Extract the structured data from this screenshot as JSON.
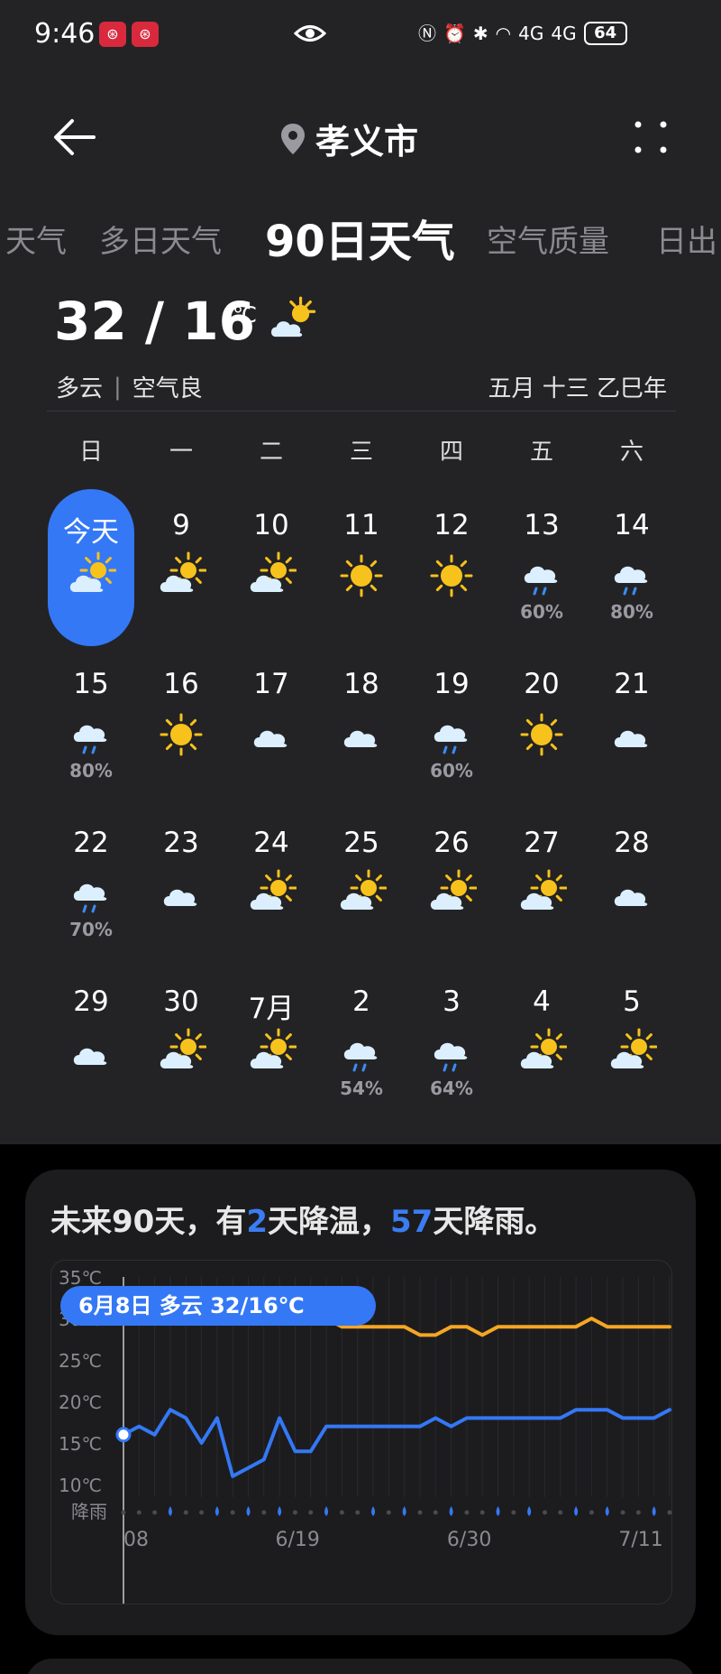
{
  "status_bar": {
    "time": "9:46",
    "badge": "AIR",
    "network": "4G",
    "battery": "64"
  },
  "header": {
    "location": "孝义市",
    "icons": [
      "back-arrow-icon",
      "location-pin-icon",
      "more-grid-icon"
    ]
  },
  "tabs": [
    {
      "label": "天气",
      "active": false
    },
    {
      "label": "多日天气",
      "active": false
    },
    {
      "label": "90日天气",
      "active": true
    },
    {
      "label": "空气质量",
      "active": false
    },
    {
      "label": "日出",
      "active": false
    }
  ],
  "today": {
    "temp": "32 / 16",
    "unit": "℃",
    "weather": "多云",
    "air": "空气良",
    "lunar": "五月 十三 乙巳年",
    "icon": "partly-cloudy-icon"
  },
  "calendar": {
    "weekdays": [
      "日",
      "一",
      "二",
      "三",
      "四",
      "五",
      "六"
    ],
    "days": [
      {
        "label": "今天",
        "icon": "partly",
        "pct": "",
        "today": true
      },
      {
        "label": "9",
        "icon": "partly",
        "pct": ""
      },
      {
        "label": "10",
        "icon": "partly",
        "pct": ""
      },
      {
        "label": "11",
        "icon": "sun",
        "pct": ""
      },
      {
        "label": "12",
        "icon": "sun",
        "pct": ""
      },
      {
        "label": "13",
        "icon": "rain",
        "pct": "60%"
      },
      {
        "label": "14",
        "icon": "rain",
        "pct": "80%"
      },
      {
        "label": "15",
        "icon": "rain",
        "pct": "80%"
      },
      {
        "label": "16",
        "icon": "sun",
        "pct": ""
      },
      {
        "label": "17",
        "icon": "cloud",
        "pct": ""
      },
      {
        "label": "18",
        "icon": "cloud",
        "pct": ""
      },
      {
        "label": "19",
        "icon": "rain",
        "pct": "60%"
      },
      {
        "label": "20",
        "icon": "sun",
        "pct": ""
      },
      {
        "label": "21",
        "icon": "cloud",
        "pct": ""
      },
      {
        "label": "22",
        "icon": "rain",
        "pct": "70%"
      },
      {
        "label": "23",
        "icon": "cloud",
        "pct": ""
      },
      {
        "label": "24",
        "icon": "partly",
        "pct": ""
      },
      {
        "label": "25",
        "icon": "partly",
        "pct": ""
      },
      {
        "label": "26",
        "icon": "partly",
        "pct": ""
      },
      {
        "label": "27",
        "icon": "partly",
        "pct": ""
      },
      {
        "label": "28",
        "icon": "cloud",
        "pct": ""
      },
      {
        "label": "29",
        "icon": "cloud",
        "pct": ""
      },
      {
        "label": "30",
        "icon": "partly",
        "pct": ""
      },
      {
        "label": "7月",
        "icon": "partly",
        "pct": ""
      },
      {
        "label": "2",
        "icon": "rain",
        "pct": "54%"
      },
      {
        "label": "3",
        "icon": "rain",
        "pct": "64%"
      },
      {
        "label": "4",
        "icon": "partly",
        "pct": ""
      },
      {
        "label": "5",
        "icon": "partly",
        "pct": ""
      }
    ]
  },
  "summary": {
    "prefix": "未来90天，有",
    "cooling_days": "2",
    "middle": "天降温，",
    "rain_days": "57",
    "suffix": "天降雨。"
  },
  "chart_data": {
    "type": "line",
    "tooltip": "6月8日  多云  32/16℃",
    "y_ticks": [
      "35℃",
      "30℃",
      "25℃",
      "20℃",
      "15℃",
      "10℃"
    ],
    "rain_label": "降雨",
    "x_ticks": [
      "08",
      "6/19",
      "6/30",
      "7/11"
    ],
    "ylim": [
      10,
      35
    ],
    "x_days": 36,
    "series": [
      {
        "color": "#f5a623",
        "values": [
          32,
          32,
          33,
          32,
          30,
          31,
          31,
          30,
          31,
          30,
          32,
          33,
          31,
          30,
          29,
          29,
          29,
          29,
          29,
          28,
          28,
          29,
          29,
          28,
          29,
          29,
          29,
          29,
          29,
          29,
          30,
          29,
          29,
          29,
          29,
          29
        ]
      },
      {
        "color": "#3478f6",
        "values": [
          16,
          17,
          16,
          19,
          18,
          15,
          18,
          11,
          12,
          13,
          18,
          14,
          14,
          17,
          17,
          17,
          17,
          17,
          17,
          17,
          18,
          17,
          18,
          18,
          18,
          18,
          18,
          18,
          18,
          19,
          19,
          19,
          18,
          18,
          18,
          19
        ]
      }
    ],
    "rain_days_marked": [
      3,
      6,
      8,
      10,
      13,
      16,
      18,
      21,
      24,
      26,
      29,
      31,
      34
    ],
    "colors": {
      "high": "#f5a623",
      "low": "#3478f6",
      "accent": "#3478f6"
    }
  }
}
